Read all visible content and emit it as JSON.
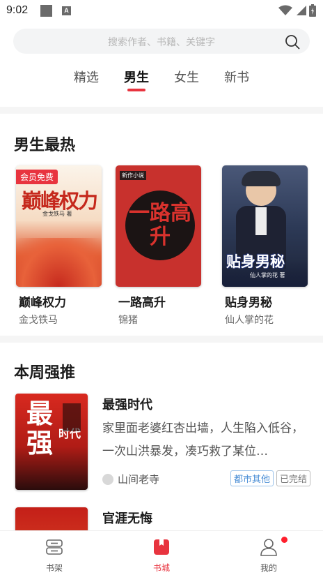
{
  "status_bar": {
    "time": "9:02",
    "notif_letter": "A"
  },
  "search": {
    "placeholder": "搜索作者、书籍、关键字"
  },
  "tabs": [
    {
      "label": "精选",
      "active": false
    },
    {
      "label": "男生",
      "active": true
    },
    {
      "label": "女生",
      "active": false
    },
    {
      "label": "新书",
      "active": false
    }
  ],
  "hot": {
    "title": "男生最热",
    "books": [
      {
        "title": "巅峰权力",
        "author": "金戈铁马",
        "badge": "会员免费",
        "cover_text": "巅峰权力",
        "cover_subtext": "金戈铁马 著"
      },
      {
        "title": "一路高升",
        "author": "锦猪",
        "cover_text": "一路高升",
        "cover_top": "新作小说"
      },
      {
        "title": "贴身男秘",
        "author": "仙人掌的花",
        "cover_text": "贴身男秘",
        "cover_subtext": "仙人掌的花 著"
      }
    ]
  },
  "weekly": {
    "title": "本周强推",
    "books": [
      {
        "title": "最强时代",
        "desc": "家里面老婆红杏出墙，人生陷入低谷，一次山洪暴发，凑巧救了某位…",
        "author": "山间老寺",
        "tags": [
          "都市其他",
          "已完结"
        ],
        "cover_text": "最强",
        "cover_sub": "时代"
      },
      {
        "title": "官涯无悔"
      }
    ]
  },
  "bottom_nav": [
    {
      "label": "书架",
      "active": false
    },
    {
      "label": "书城",
      "active": true
    },
    {
      "label": "我的",
      "active": false,
      "dot": true
    }
  ],
  "colors": {
    "accent": "#e8343f",
    "tag_blue": "#4c8fd6"
  }
}
